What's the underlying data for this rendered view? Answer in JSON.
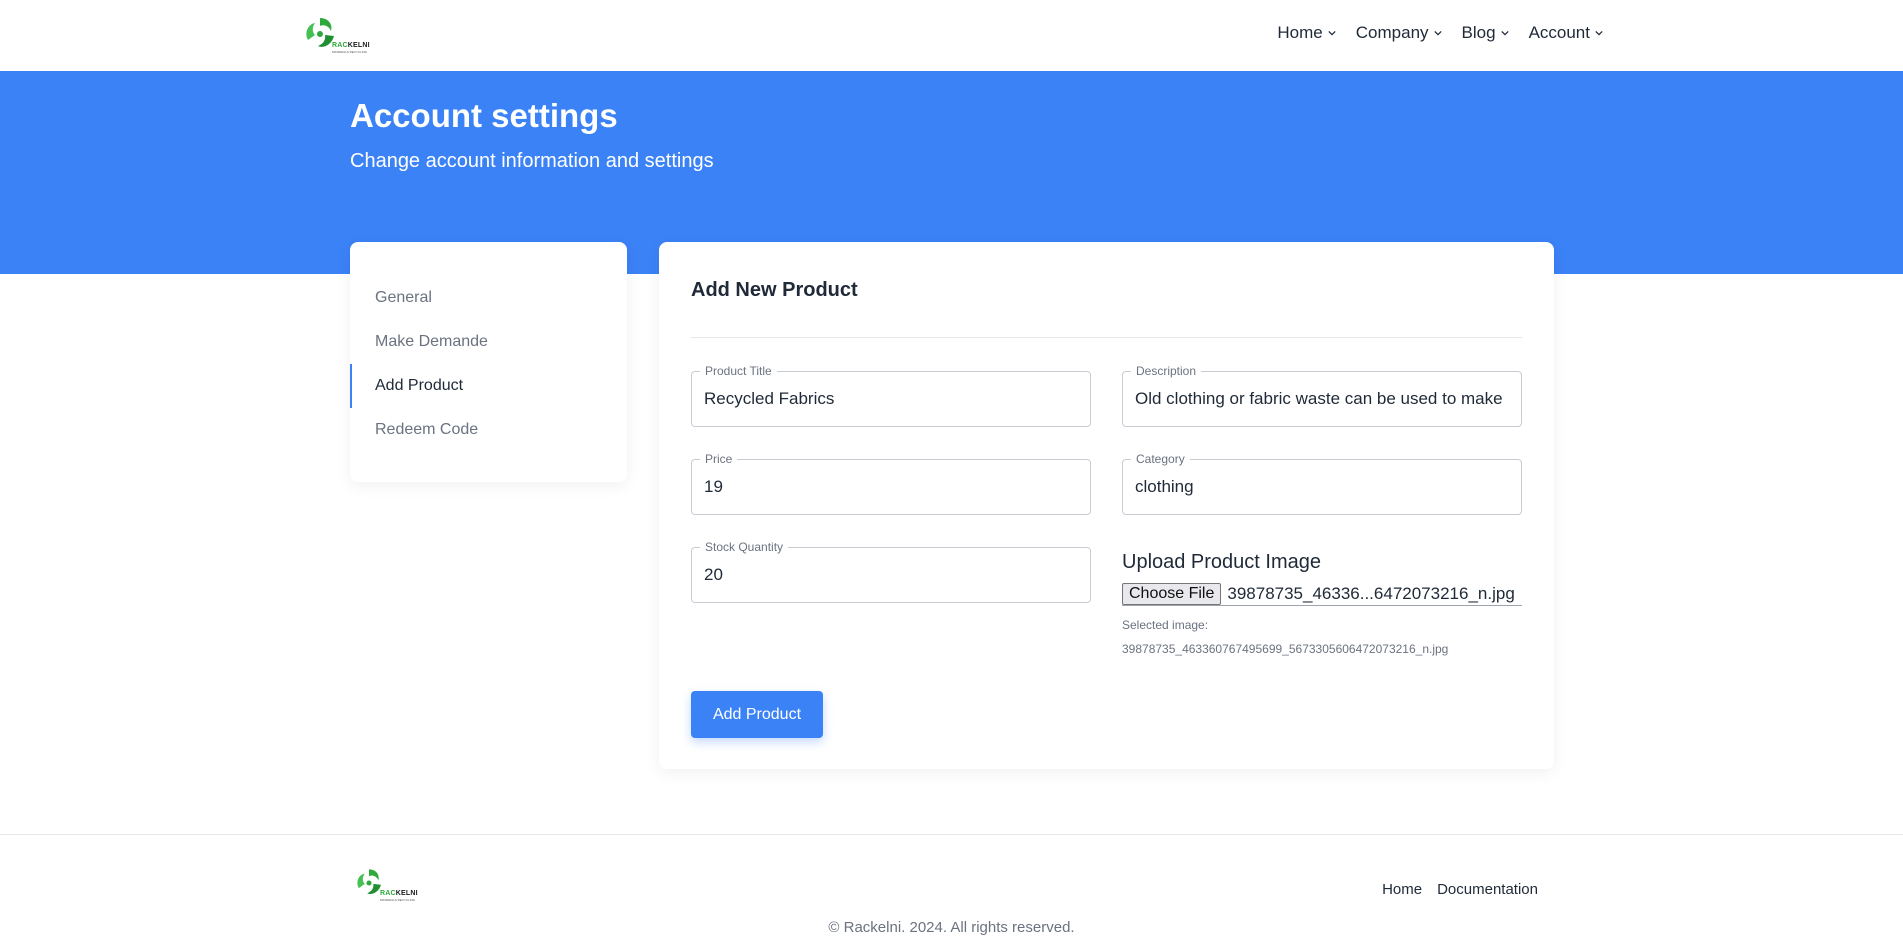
{
  "header": {
    "logo_text_green": "RAC",
    "logo_text_dark": "KELNI",
    "logo_sub": "MATERIALS RECYCLING",
    "nav": [
      "Home",
      "Company",
      "Blog",
      "Account"
    ]
  },
  "hero": {
    "title": "Account settings",
    "subtitle": "Change account information and settings"
  },
  "sidebar": {
    "items": [
      {
        "label": "General",
        "active": false
      },
      {
        "label": "Make Demande",
        "active": false
      },
      {
        "label": "Add Product",
        "active": true
      },
      {
        "label": "Redeem Code",
        "active": false
      }
    ]
  },
  "form": {
    "title": "Add New Product",
    "product_title": {
      "label": "Product Title",
      "value": "Recycled Fabrics"
    },
    "description": {
      "label": "Description",
      "value": "Old clothing or fabric waste can be used to make"
    },
    "price": {
      "label": "Price",
      "value": "19"
    },
    "category": {
      "label": "Category",
      "value": "clothing"
    },
    "stock": {
      "label": "Stock Quantity",
      "value": "20"
    },
    "upload": {
      "title": "Upload Product Image",
      "button": "Choose File",
      "file_display": "39878735_46336...6472073216_n.jpg",
      "selected_label": "Selected image:",
      "selected_name": "39878735_463360767495699_5673305606472073216_n.jpg"
    },
    "submit": "Add Product"
  },
  "footer": {
    "links": [
      "Home",
      "Documentation"
    ],
    "copyright": "© Rackelni. 2024. All rights reserved."
  },
  "colors": {
    "primary": "#3b82f6",
    "logo_green": "#2eaa3c"
  }
}
